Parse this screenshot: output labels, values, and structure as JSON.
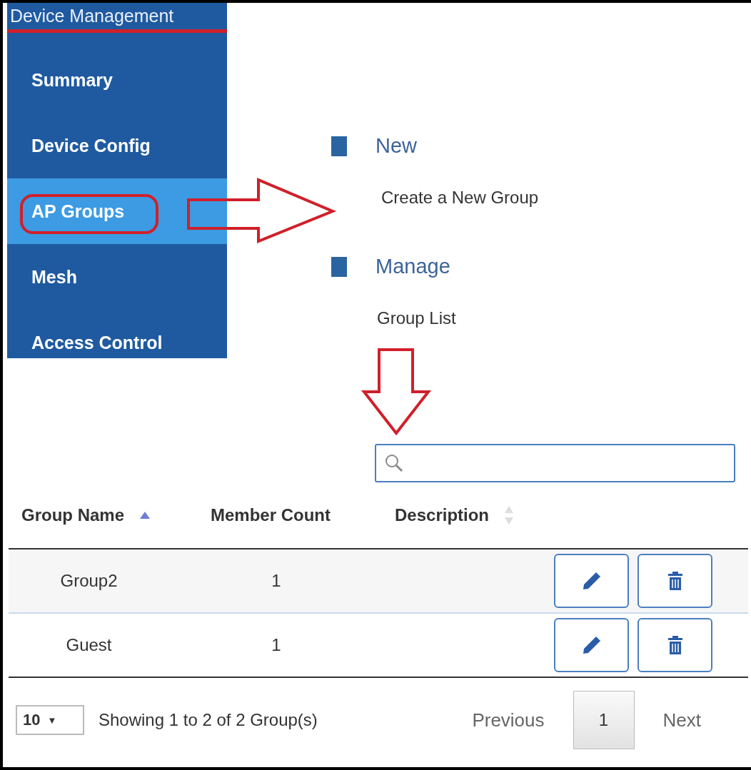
{
  "sidebar": {
    "title": "Device Management",
    "items": [
      {
        "label": "Summary",
        "selected": false
      },
      {
        "label": "Device Config",
        "selected": false
      },
      {
        "label": "AP Groups",
        "selected": true
      },
      {
        "label": "Mesh",
        "selected": false
      },
      {
        "label": "Access Control",
        "selected": false
      }
    ]
  },
  "sections": [
    {
      "heading": "New",
      "links": [
        "Create a New Group"
      ]
    },
    {
      "heading": "Manage",
      "links": [
        "Group List"
      ]
    }
  ],
  "table": {
    "columns": [
      {
        "label": "Group Name",
        "sorted": true
      },
      {
        "label": "Member Count"
      },
      {
        "label": "Description",
        "sorted": false
      }
    ],
    "rows": [
      {
        "group_name": "Group2",
        "member_count": "1"
      },
      {
        "group_name": "Guest",
        "member_count": "1"
      }
    ]
  },
  "footer": {
    "page_size": "10",
    "page_size_caret": "▼",
    "info": "Showing 1 to 2 of 2 Group(s)",
    "previous": "Previous",
    "pages": [
      {
        "label": "1",
        "selected": true
      }
    ],
    "next": "Next"
  },
  "annotations": [
    {
      "kind": "ellipse"
    },
    {
      "kind": "arrow-right"
    },
    {
      "kind": "arrow-down"
    }
  ]
}
